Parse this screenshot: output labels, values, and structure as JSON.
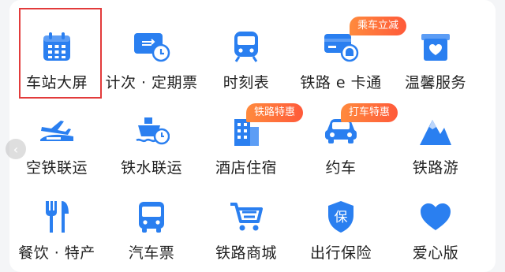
{
  "colors": {
    "icon_blue": "#2a7ff0",
    "icon_light": "#bcd6fb",
    "badge": "#ff6a3a",
    "selection": "#e23b3b"
  },
  "nav": {
    "prev_arrow": "‹"
  },
  "grid": [
    {
      "label": "车站大屏",
      "icon": "calendar-icon",
      "selected": true
    },
    {
      "label": "计次 · 定期票",
      "icon": "ticket-clock-icon"
    },
    {
      "label": "时刻表",
      "icon": "train-front-icon"
    },
    {
      "label": "铁路 e 卡通",
      "icon": "e-card-icon",
      "badge": "乘车立减"
    },
    {
      "label": "温馨服务",
      "icon": "heart-box-icon"
    },
    {
      "label": "空铁联运",
      "icon": "plane-train-icon"
    },
    {
      "label": "铁水联运",
      "icon": "ship-clock-icon"
    },
    {
      "label": "酒店住宿",
      "icon": "hotel-icon",
      "badge": "铁路特惠"
    },
    {
      "label": "约车",
      "icon": "car-icon",
      "badge": "打车特惠"
    },
    {
      "label": "铁路游",
      "icon": "mountain-icon"
    },
    {
      "label": "餐饮 · 特产",
      "icon": "fork-knife-icon"
    },
    {
      "label": "汽车票",
      "icon": "bus-icon"
    },
    {
      "label": "铁路商城",
      "icon": "cart-icon"
    },
    {
      "label": "出行保险",
      "icon": "shield-bao-icon"
    },
    {
      "label": "爱心版",
      "icon": "heart-icon"
    }
  ]
}
